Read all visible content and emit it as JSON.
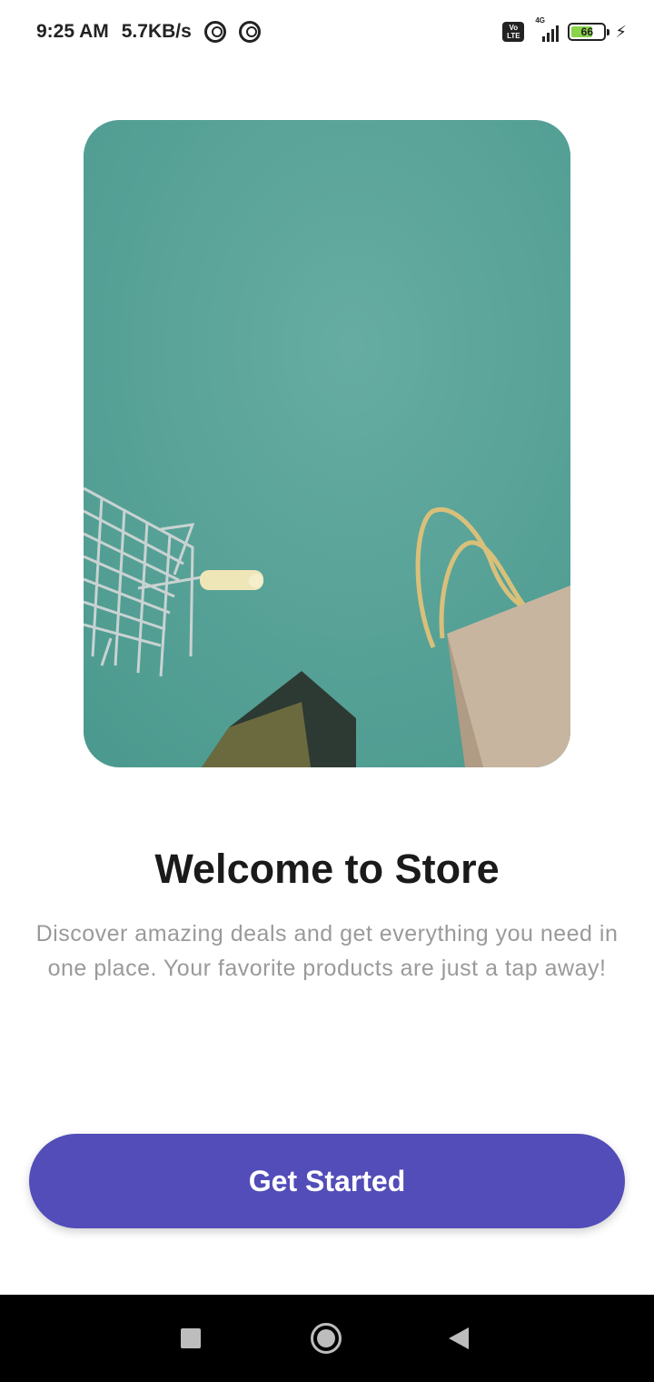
{
  "status_bar": {
    "time": "9:25 AM",
    "network_speed": "5.7KB/s",
    "left_icons": [
      "sync-circle-icon",
      "sync-circle-icon"
    ],
    "volte_label": "Vo LTE",
    "network_type": "4G",
    "battery_level": "66",
    "charging": true
  },
  "hero": {
    "icon_name": "shopping-cart-and-bag-photo",
    "background_color": "#5aa39a"
  },
  "welcome": {
    "title": "Welcome to Store",
    "description": "Discover amazing deals and get everything you need in one place. Your favorite products are just a tap away!"
  },
  "cta": {
    "label": "Get Started",
    "color": "#524db8"
  },
  "nav_bar": {
    "buttons": [
      "recents-icon",
      "home-icon",
      "back-icon"
    ]
  }
}
